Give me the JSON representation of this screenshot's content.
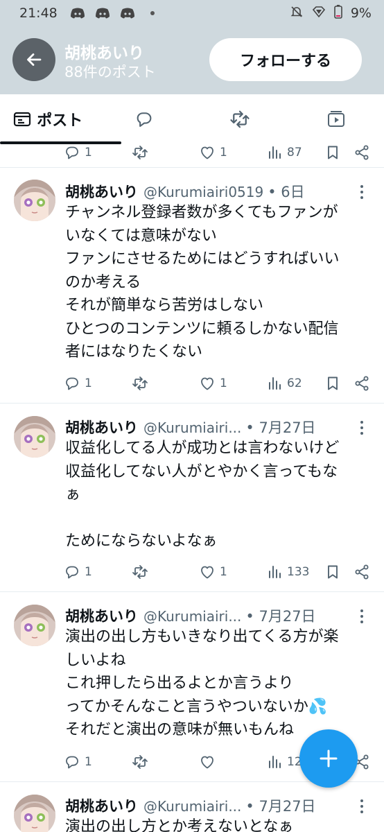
{
  "status_bar": {
    "time": "21:48",
    "battery": "9%"
  },
  "header": {
    "name": "胡桃あいり",
    "post_count": "88件のポスト",
    "follow_label": "フォローする"
  },
  "tabs": [
    {
      "label": "ポスト"
    }
  ],
  "top_partial": {
    "replies": "1",
    "likes": "1",
    "views": "87"
  },
  "posts": [
    {
      "name": "胡桃あいり",
      "handle": "@Kurumiairi0519",
      "date": "• 6日",
      "text": "チャンネル登録者数が多くてもファンが\nいなくては意味がない\nファンにさせるためにはどうすればいい\nのか考える\nそれが簡単なら苦労はしない\nひとつのコンテンツに頼るしかない配信\n者にはなりたくない",
      "replies": "1",
      "likes": "1",
      "views": "62"
    },
    {
      "name": "胡桃あいり",
      "handle": "@Kurumiairi...",
      "date": "• 7月27日",
      "text": "収益化してる人が成功とは言わないけど\n収益化してない人がとやかく言ってもな\nぁ\n\nためにならないよなぁ",
      "replies": "1",
      "likes": "1",
      "views": "133"
    },
    {
      "name": "胡桃あいり",
      "handle": "@Kurumiairi...",
      "date": "• 7月27日",
      "text": "演出の出し方もいきなり出てくる方が楽\nしいよね\nこれ押したら出るよとか言うより\nってかそんなこと言うやついないか💦\nそれだと演出の意味が無いもんね",
      "replies": "1",
      "likes": "",
      "views": "12"
    },
    {
      "name": "胡桃あいり",
      "handle": "@Kurumiairi...",
      "date": "• 7月27日",
      "text": "演出の出し方とか考えないとなぁ"
    }
  ],
  "colors": {
    "accent": "#1d9bf0",
    "header_bg": "#cfd9de",
    "secondary_text": "#536471"
  }
}
